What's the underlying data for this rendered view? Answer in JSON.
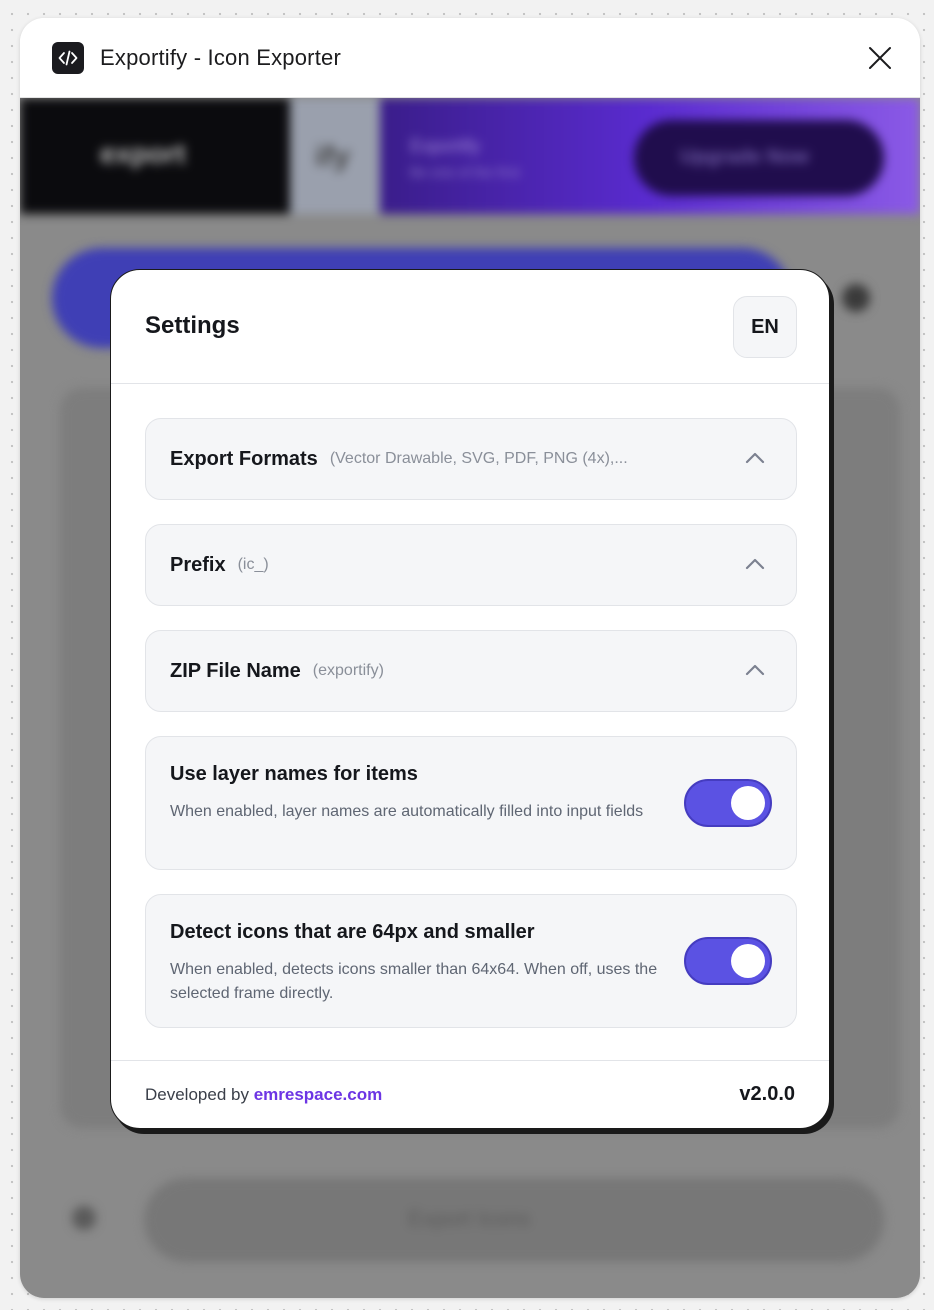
{
  "window": {
    "title": "Exportify - Icon Exporter"
  },
  "background": {
    "brand_text": "export",
    "mark_text": "ify",
    "promo_title": "Exportify",
    "promo_subtitle": "Be one of the first",
    "upgrade_label": "Upgrade Now",
    "export_label": "Export Icons"
  },
  "settings": {
    "title": "Settings",
    "language": "EN",
    "accordions": [
      {
        "title": "Export Formats",
        "hint": "(Vector Drawable, SVG, PDF, PNG (4x),..."
      },
      {
        "title": "Prefix",
        "hint": "(ic_)"
      },
      {
        "title": "ZIP File Name",
        "hint": "(exportify)"
      }
    ],
    "toggles": [
      {
        "title": "Use layer names for items",
        "description": "When enabled, layer names are automatically filled into input fields",
        "enabled": true
      },
      {
        "title": "Detect icons that are 64px and smaller",
        "description": "When enabled, detects icons smaller than 64x64. When off, uses the selected frame directly.",
        "enabled": true
      }
    ],
    "footer": {
      "developed_by": "Developed by",
      "link": "emrespace.com",
      "version": "v2.0.0"
    }
  },
  "colors": {
    "accent": "#5b52e3",
    "link": "#6d35e4",
    "purple_banner": "#5a2bd0"
  },
  "icons": {
    "app_logo": "code-icon",
    "close": "close-icon",
    "accordion": "chevron-up-icon"
  }
}
